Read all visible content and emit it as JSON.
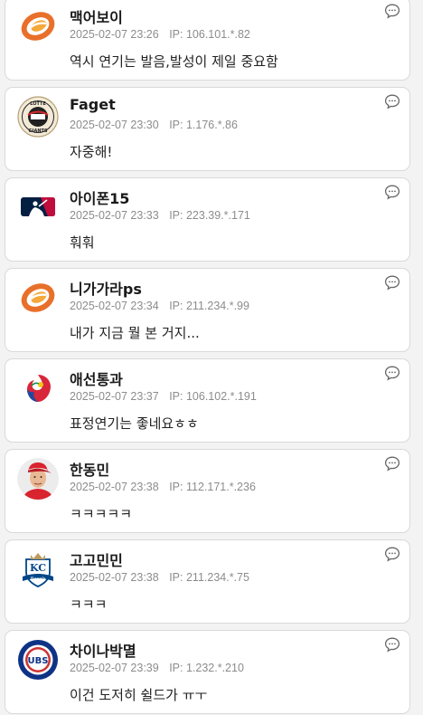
{
  "comments": [
    {
      "nickname": "맥어보이",
      "date": "2025-02-07 23:26",
      "ip_label": "IP:",
      "ip": "106.101.*.82",
      "text": "역시 연기는 발음,발성이 제일 중요함",
      "avatar": "kia-tigers-logo-icon"
    },
    {
      "nickname": "Faget",
      "date": "2025-02-07 23:30",
      "ip_label": "IP:",
      "ip": "1.176.*.86",
      "text": "자중해!",
      "avatar": "lotte-giants-logo-icon"
    },
    {
      "nickname": "아이폰15",
      "date": "2025-02-07 23:33",
      "ip_label": "IP:",
      "ip": "223.39.*.171",
      "text": "훠훠",
      "avatar": "mlb-logo-icon"
    },
    {
      "nickname": "니가가라ps",
      "date": "2025-02-07 23:34",
      "ip_label": "IP:",
      "ip": "211.234.*.99",
      "text": "내가 지금 뭘 본 거지...",
      "avatar": "kia-tigers-logo-icon"
    },
    {
      "nickname": "애선통과",
      "date": "2025-02-07 23:37",
      "ip_label": "IP:",
      "ip": "106.102.*.191",
      "text": "표정연기는 좋네요ㅎㅎ",
      "avatar": "kbo-logo-icon"
    },
    {
      "nickname": "한동민",
      "date": "2025-02-07 23:38",
      "ip_label": "IP:",
      "ip": "112.171.*.236",
      "text": "ㅋㅋㅋㅋㅋ",
      "avatar": "player-photo-icon"
    },
    {
      "nickname": "고고민민",
      "date": "2025-02-07 23:38",
      "ip_label": "IP:",
      "ip": "211.234.*.75",
      "text": "ㅋㅋㅋ",
      "avatar": "kc-royals-logo-icon"
    },
    {
      "nickname": "차이나박멸",
      "date": "2025-02-07 23:39",
      "ip_label": "IP:",
      "ip": "1.232.*.210",
      "text": "이건 도저히 쉴드가 ㅠㅜ",
      "avatar": "chicago-cubs-logo-icon"
    }
  ],
  "colors": {
    "card_bg": "#ffffff",
    "card_border": "#d9d9d9",
    "page_bg": "#f3f3f3",
    "meta_text": "#8c8c8c",
    "kia_orange": "#e8702a",
    "cubs_blue": "#0e3386",
    "cubs_red": "#cc3433",
    "mlb_blue": "#041e42",
    "mlb_red": "#bf0d3e",
    "royals_blue": "#004687"
  }
}
